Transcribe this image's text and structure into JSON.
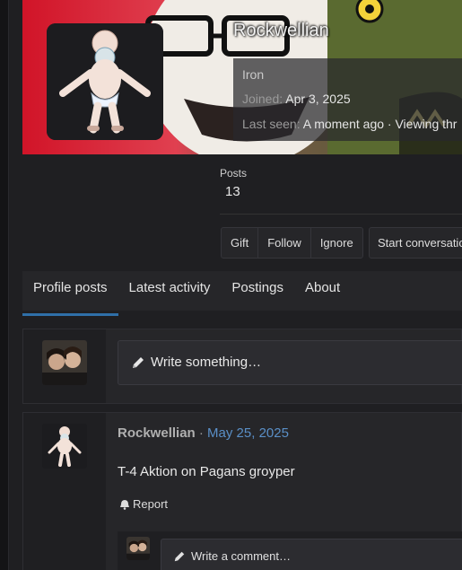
{
  "profile": {
    "username": "Rockwellian",
    "title": "Iron",
    "joined_label": "Joined:",
    "joined_value": "Apr 3, 2025",
    "last_seen_label": "Last seen:",
    "last_seen_value": "A moment ago",
    "activity": "· Viewing thr",
    "stats": {
      "posts_label": "Posts",
      "posts_value": "13"
    }
  },
  "actions": {
    "gift": "Gift",
    "follow": "Follow",
    "ignore": "Ignore",
    "start_conversation": "Start conversatio"
  },
  "tabs": [
    {
      "label": "Profile posts",
      "active": true
    },
    {
      "label": "Latest activity"
    },
    {
      "label": "Postings"
    },
    {
      "label": "About"
    }
  ],
  "composer": {
    "placeholder": "Write something…"
  },
  "posts": [
    {
      "author": "Rockwellian",
      "separator": "·",
      "date": "May 25, 2025",
      "body": "T-4 Aktion on Pagans groyper",
      "report_label": "Report",
      "comment_placeholder": "Write a comment…"
    }
  ],
  "colors": {
    "accent": "#2f6fa8",
    "date_link": "#5a8fc7",
    "banner_red": "#c8102e"
  },
  "icons": {
    "compose": "pencil-icon",
    "report": "bell-icon"
  }
}
